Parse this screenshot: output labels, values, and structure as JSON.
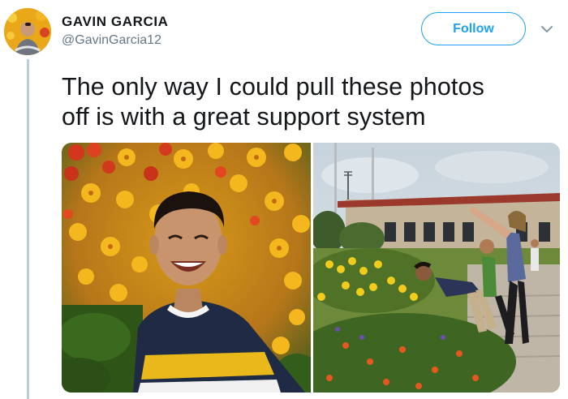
{
  "author": {
    "display_name": "GAVIN GARCIA",
    "handle": "@GavinGarcia12"
  },
  "follow_button": {
    "label": "Follow"
  },
  "tweet": {
    "text_line1": "The only way I could pull these photos",
    "text_line2": "off is with a great support system"
  },
  "icons": {
    "caret": "chevron-down-icon"
  },
  "colors": {
    "accent": "#1da1f2",
    "thread_line": "#b7cde3",
    "handle_gray": "#657786"
  }
}
